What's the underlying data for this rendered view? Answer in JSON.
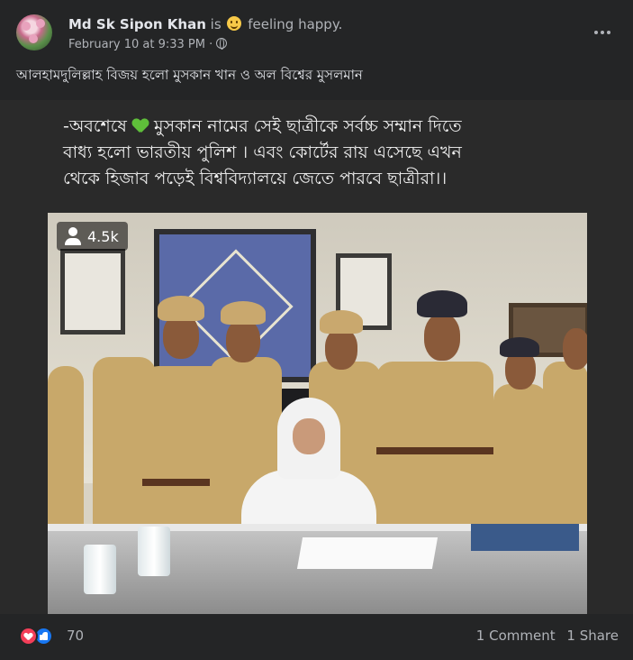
{
  "post": {
    "author": "Md Sk Sipon Khan",
    "is_text": "is",
    "feeling_text": "feeling happy.",
    "timestamp": "February 10 at 9:33 PM",
    "separator": "·",
    "caption": "আলহামদুলিল্লাহ বিজয় হলো মুসকান খান ও অল বিশ্বের মুসলমান"
  },
  "media": {
    "overlay_line1_a": "-অবশেষে ",
    "overlay_line1_b": " মুসকান নামের সেই ছাত্রীকে সর্বচ্চ সম্মান দিতে",
    "overlay_line2": "বাধ্য হলো ভারতীয় পুলিশ । এবং কোর্টের রায় এসেছে এখন",
    "overlay_line3": "থেকে হিজাব পড়েই বিশ্ববিদ্যালয়ে জেতে পারবে ছাত্রীরা।।",
    "views": "4.5k"
  },
  "footer": {
    "reaction_count": "70",
    "comments": "1 Comment",
    "shares": "1 Share"
  },
  "icons": {
    "feeling": "smiley-emoji-icon",
    "audience": "globe-icon",
    "menu": "more-horizontal-icon",
    "views": "user-icon",
    "reactions": [
      "love-reaction-icon",
      "like-reaction-icon"
    ],
    "inline": "green-heart-emoji"
  },
  "colors": {
    "background": "#242526",
    "text_primary": "#e4e6eb",
    "text_secondary": "#b0b3b8",
    "love": "#f33e58",
    "like": "#1877f2",
    "green_heart": "#5fbf3a"
  }
}
